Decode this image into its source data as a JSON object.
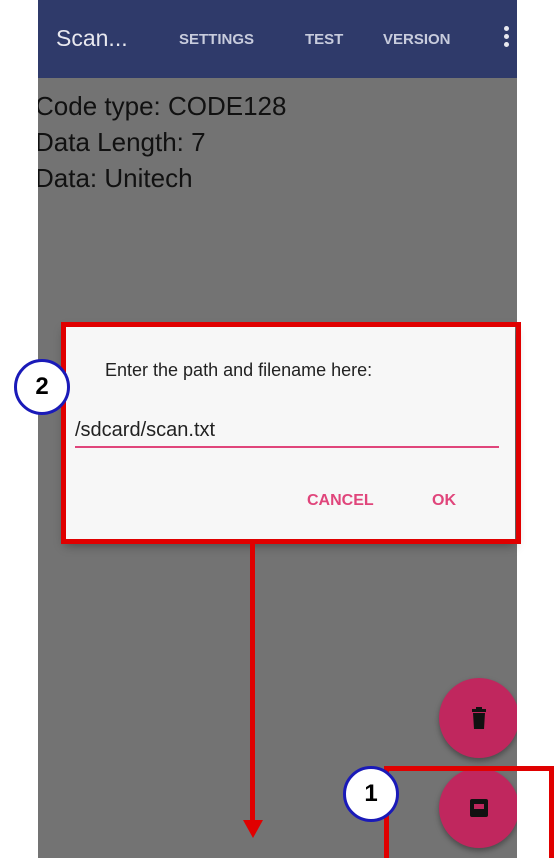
{
  "appbar": {
    "title": "Scan...",
    "menu": [
      "SETTINGS",
      "TEST",
      "VERSION"
    ],
    "overflow_icon": "more-vert-icon",
    "color": "#2f3a6a"
  },
  "scan_result": {
    "code_type": "Code type: CODE128",
    "data_length": "Data Length: 7",
    "data": "Data: Unitech"
  },
  "dialog": {
    "prompt": "Enter the path and filename here:",
    "path_value": "/sdcard/scan.txt",
    "cancel_label": "CANCEL",
    "ok_label": "OK",
    "accent": "#e0457b"
  },
  "fabs": {
    "delete_icon": "trash-icon",
    "save_icon": "save-icon",
    "color": "#c0275e"
  },
  "annotations": {
    "badge_1": "1",
    "badge_2": "2"
  }
}
